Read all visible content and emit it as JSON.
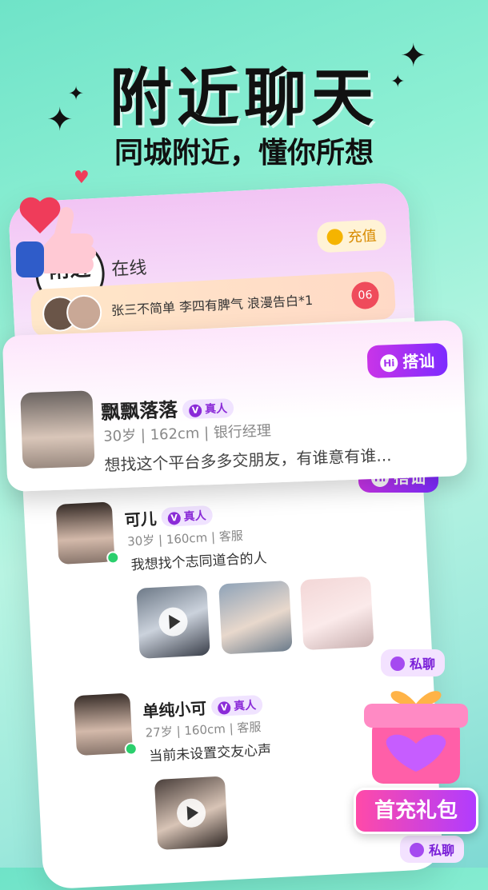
{
  "headline": {
    "title": "附近聊天",
    "subtitle": "同城附近，懂你所想"
  },
  "app": {
    "logo_text": "附近",
    "tab_online": "在线",
    "recharge_label": "充值",
    "gossip": {
      "text": "张三不简单  李四有脾气  浪漫告白*1",
      "heart_count": "06"
    }
  },
  "featured": {
    "name": "飘飘落落",
    "badge": "真人",
    "meta": "30岁 | 162cm | 银行经理",
    "intro": "想找这个平台多多交朋友，有谁意有谁...",
    "action": "搭讪"
  },
  "users": [
    {
      "name": "可儿",
      "badge": "真人",
      "meta": "30岁 | 160cm | 客服",
      "intro": "我想找个志同道合的人",
      "action": "搭讪"
    },
    {
      "name": "单纯小可",
      "badge": "真人",
      "meta": "27岁 | 160cm | 客服",
      "intro": "当前未设置交友心声",
      "action": "私聊"
    },
    {
      "action": "私聊"
    }
  ],
  "gift": {
    "label": "首充礼包"
  },
  "colors": {
    "accent": "#8b2bd8",
    "button": "#c934e8",
    "bg": "#8ff0d4"
  }
}
